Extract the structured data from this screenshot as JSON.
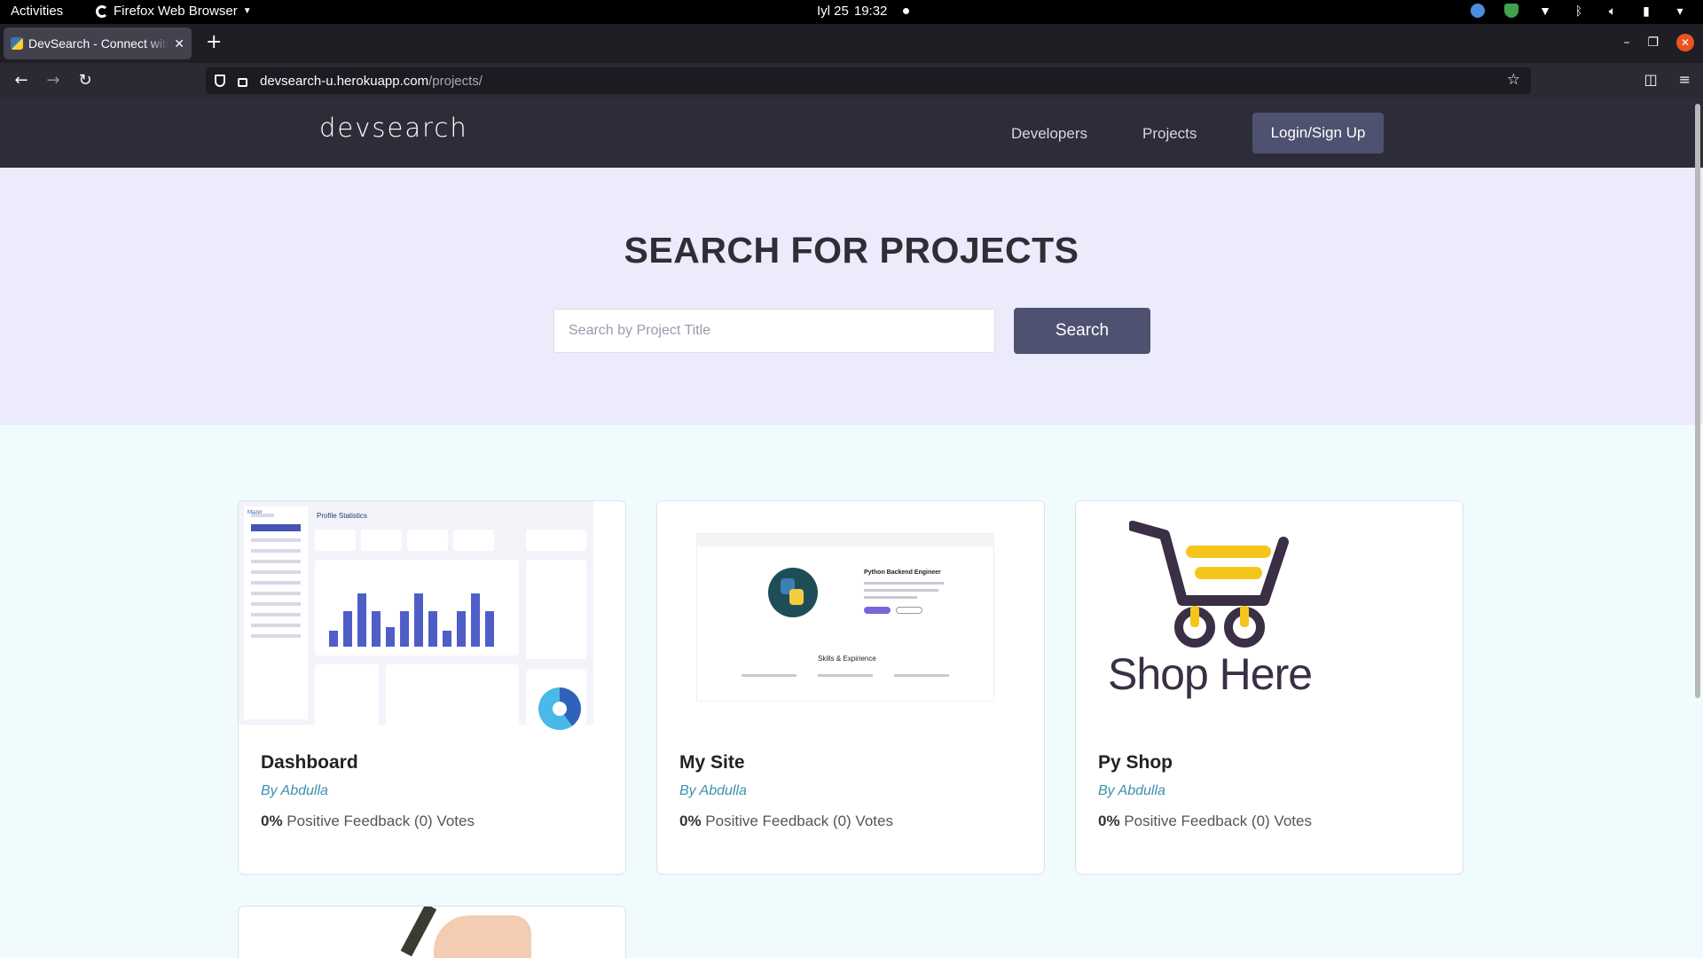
{
  "system": {
    "activities": "Activities",
    "app_name": "Firefox Web Browser",
    "date": "Iyl 25",
    "time": "19:32"
  },
  "browser": {
    "tab_title": "DevSearch - Connect with Developers",
    "url_host": "devsearch-u.herokuapp.com",
    "url_path": "/projects/"
  },
  "site": {
    "logo": "devsearch",
    "nav": {
      "developers": "Developers",
      "projects": "Projects",
      "login": "Login/Sign Up"
    },
    "hero": {
      "title_prefix": "SEARCH FOR ",
      "title_bold": "PROJECTS",
      "search_placeholder": "Search by Project Title",
      "search_button": "Search"
    },
    "projects": [
      {
        "title": "Dashboard",
        "author": "By Abdulla",
        "feedback_pct": "0%",
        "feedback_text": " Positive Feedback (0) Votes"
      },
      {
        "title": "My Site",
        "author": "By Abdulla",
        "feedback_pct": "0%",
        "feedback_text": " Positive Feedback (0) Votes"
      },
      {
        "title": "Py Shop",
        "author": "By Abdulla",
        "feedback_pct": "0%",
        "feedback_text": " Positive Feedback (0) Votes"
      }
    ],
    "thumb_text": {
      "dash_title": "Profile Statistics",
      "dash_brand": "Mazer",
      "site_heading": "Python Backend Engineer",
      "site_skills": "Skills & Expirience",
      "shop_logo": "Shop Here"
    }
  }
}
